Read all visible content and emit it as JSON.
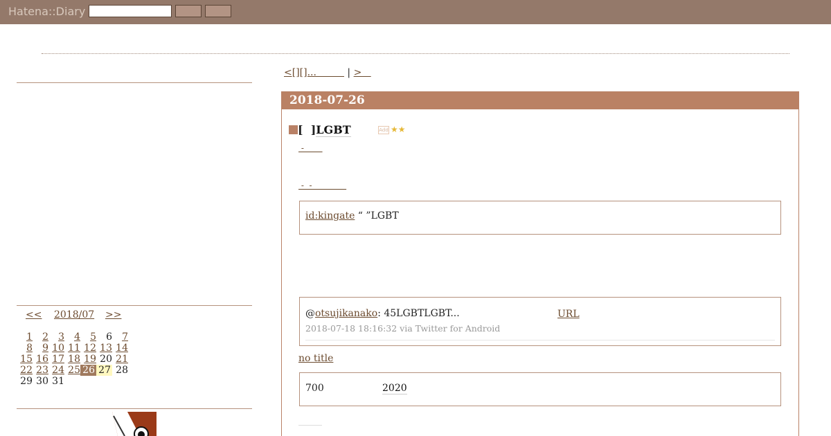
{
  "header": {
    "logo": "Hatena::Diary",
    "search_value": ""
  },
  "pager": {
    "prev": "<[][]...         ",
    "separator": " | ",
    "next": ">   "
  },
  "entry": {
    "date": "2018-07-26",
    "bracket": "[  ]",
    "title": "LGBT",
    "star_add": "Add",
    "stars": "★★",
    "sublink1": " -       ",
    "sublink2": " -  -             ",
    "quote1": {
      "user": "id:kingate",
      "text": " “  ”LGBT"
    },
    "tweet": {
      "at": "@",
      "user": "otsujikanako",
      "text": ": 45LGBTLGBT...",
      "url_label": "URL",
      "meta": "2018-07-18 18:16:32 via Twitter for Android"
    },
    "notitle": "no title",
    "quote3": {
      "number": "700",
      "year": "2020"
    }
  },
  "calendar": {
    "prev": "<<",
    "month": "2018/07",
    "next": ">>",
    "weeks": [
      [
        "",
        "",
        "",
        "",
        "",
        "",
        ""
      ],
      [
        "1",
        "2",
        "3",
        "4",
        "5",
        "6",
        "7"
      ],
      [
        "8",
        "9",
        "10",
        "11",
        "12",
        "13",
        "14"
      ],
      [
        "15",
        "16",
        "17",
        "18",
        "19",
        "20",
        "21"
      ],
      [
        "22",
        "23",
        "24",
        "25",
        "26",
        "27",
        "28"
      ],
      [
        "29",
        "30",
        "31",
        "",
        "",
        "",
        ""
      ]
    ]
  },
  "colors": {
    "topbar": "#94796a",
    "accent": "#ba8164",
    "link": "#6b4a2e"
  }
}
